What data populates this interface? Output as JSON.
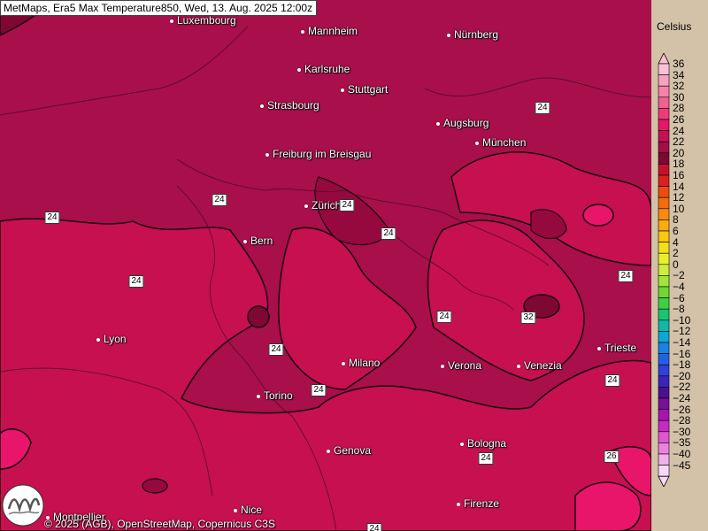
{
  "title": "MetMaps, Era5 Max Temperature850, Wed, 13. Aug. 2025 12:00z",
  "credit": "© 2025 (AGB), OpenStreetMap, Copernicus C3S",
  "unit": "Celsius",
  "cities": [
    {
      "name": "Luxembourg"
    },
    {
      "name": "Mannheim"
    },
    {
      "name": "Nürnberg"
    },
    {
      "name": "Karlsruhe"
    },
    {
      "name": "Stuttgart"
    },
    {
      "name": "Strasbourg"
    },
    {
      "name": "Augsburg"
    },
    {
      "name": "München"
    },
    {
      "name": "Freiburg im Breisgau"
    },
    {
      "name": "Zürich"
    },
    {
      "name": "Bern"
    },
    {
      "name": "Lyon"
    },
    {
      "name": "Milano"
    },
    {
      "name": "Verona"
    },
    {
      "name": "Venezia"
    },
    {
      "name": "Trieste"
    },
    {
      "name": "Torino"
    },
    {
      "name": "Genova"
    },
    {
      "name": "Bologna"
    },
    {
      "name": "Firenze"
    },
    {
      "name": "Nice"
    },
    {
      "name": "Montpellier"
    }
  ],
  "contour_labels": [
    "24",
    "24",
    "24",
    "24",
    "24",
    "24",
    "24",
    "24",
    "24",
    "24",
    "24",
    "32",
    "24",
    "26",
    "24"
  ],
  "legend": {
    "ticks": [
      "36",
      "34",
      "32",
      "30",
      "28",
      "26",
      "24",
      "22",
      "20",
      "18",
      "16",
      "14",
      "12",
      "10",
      "8",
      "6",
      "4",
      "2",
      "0",
      "−2",
      "−4",
      "−6",
      "−8",
      "−10",
      "−12",
      "−14",
      "−16",
      "−18",
      "−20",
      "−22",
      "−24",
      "−26",
      "−28",
      "−30",
      "−35",
      "−40",
      "−45"
    ],
    "colors": [
      "#f9c1d6",
      "#f7a3bf",
      "#f582aa",
      "#f25f93",
      "#ee3a7c",
      "#e8156a",
      "#c70f55",
      "#a30e48",
      "#7e0733",
      "#c8102e",
      "#de2020",
      "#f04a0f",
      "#f66b0c",
      "#f98a0c",
      "#fbaa0f",
      "#f9c80f",
      "#f2e01a",
      "#e9ef2d",
      "#cdee3d",
      "#a2e43a",
      "#6ed832",
      "#3cd046",
      "#19c472",
      "#0fb8a8",
      "#0ea6d6",
      "#1583e8",
      "#2162e5",
      "#2f41d8",
      "#3b24b8",
      "#4c0f8e",
      "#7a0f99",
      "#a714b0",
      "#c82ac4",
      "#e056d4",
      "#ea82e0",
      "#f1b0ec",
      "#f7d9f5"
    ]
  }
}
